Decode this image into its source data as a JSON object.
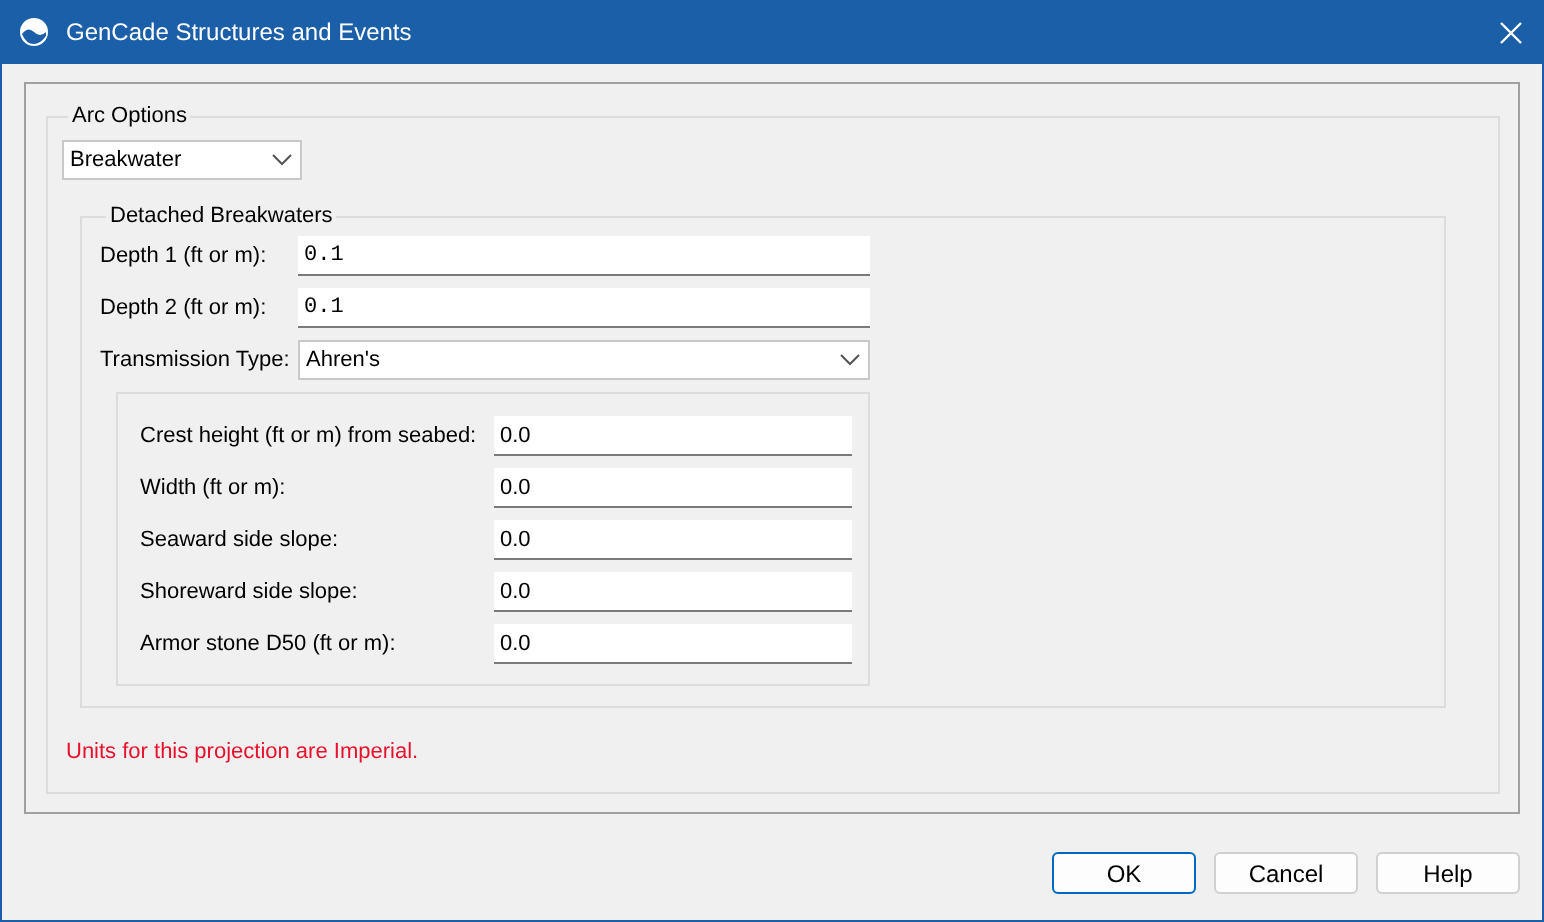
{
  "window": {
    "title": "GenCade Structures and Events"
  },
  "arc_options": {
    "label": "Arc Options",
    "arc_type": {
      "value": "Breakwater"
    },
    "detached_breakwaters": {
      "label": "Detached Breakwaters",
      "depths": [
        {
          "label": "Depth 1 (ft or m):",
          "value": "0.1"
        },
        {
          "label": "Depth 2 (ft or m):",
          "value": "0.1"
        }
      ],
      "transmission_type": {
        "label": "Transmission Type:",
        "value": "Ahren's"
      },
      "parameters": [
        {
          "label": "Crest height (ft or m) from seabed:",
          "value": "0.0"
        },
        {
          "label": "Width (ft or m):",
          "value": "0.0"
        },
        {
          "label": "Seaward side slope:",
          "value": "0.0"
        },
        {
          "label": "Shoreward side slope:",
          "value": "0.0"
        },
        {
          "label": "Armor stone D50 (ft or m):",
          "value": "0.0"
        }
      ]
    },
    "units_note": "Units for this projection are Imperial."
  },
  "buttons": [
    {
      "label": "OK",
      "default": true
    },
    {
      "label": "Cancel",
      "default": false
    },
    {
      "label": "Help",
      "default": false
    }
  ]
}
